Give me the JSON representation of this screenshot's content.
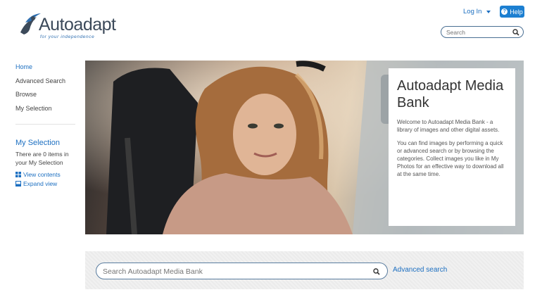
{
  "header": {
    "logo_text": "Autoadapt",
    "logo_tagline": "for your independence",
    "login_label": "Log In",
    "help_label": "Help",
    "search_placeholder": "Search"
  },
  "sidebar": {
    "nav": [
      {
        "label": "Home"
      },
      {
        "label": "Advanced Search"
      },
      {
        "label": "Browse"
      },
      {
        "label": "My Selection"
      }
    ],
    "my_selection": {
      "title": "My Selection",
      "text": "There are 0 items in your My Selection",
      "view_contents": "View contents",
      "expand_view": "Expand view"
    }
  },
  "hero": {
    "title": "Autoadapt Media Bank",
    "paragraph1": "Welcome to Autoadapt Media Bank - a library of images and other digital assets.",
    "paragraph2": "You can find images by performing a quick or advanced search or by browsing the categories. Collect images you like in My Photos for an effective way to download all at the same time."
  },
  "main_search": {
    "placeholder": "Search Autoadapt Media Bank",
    "advanced_link": "Advanced search"
  },
  "colors": {
    "accent": "#1c6fc1",
    "help_button": "#1c7fd1"
  }
}
